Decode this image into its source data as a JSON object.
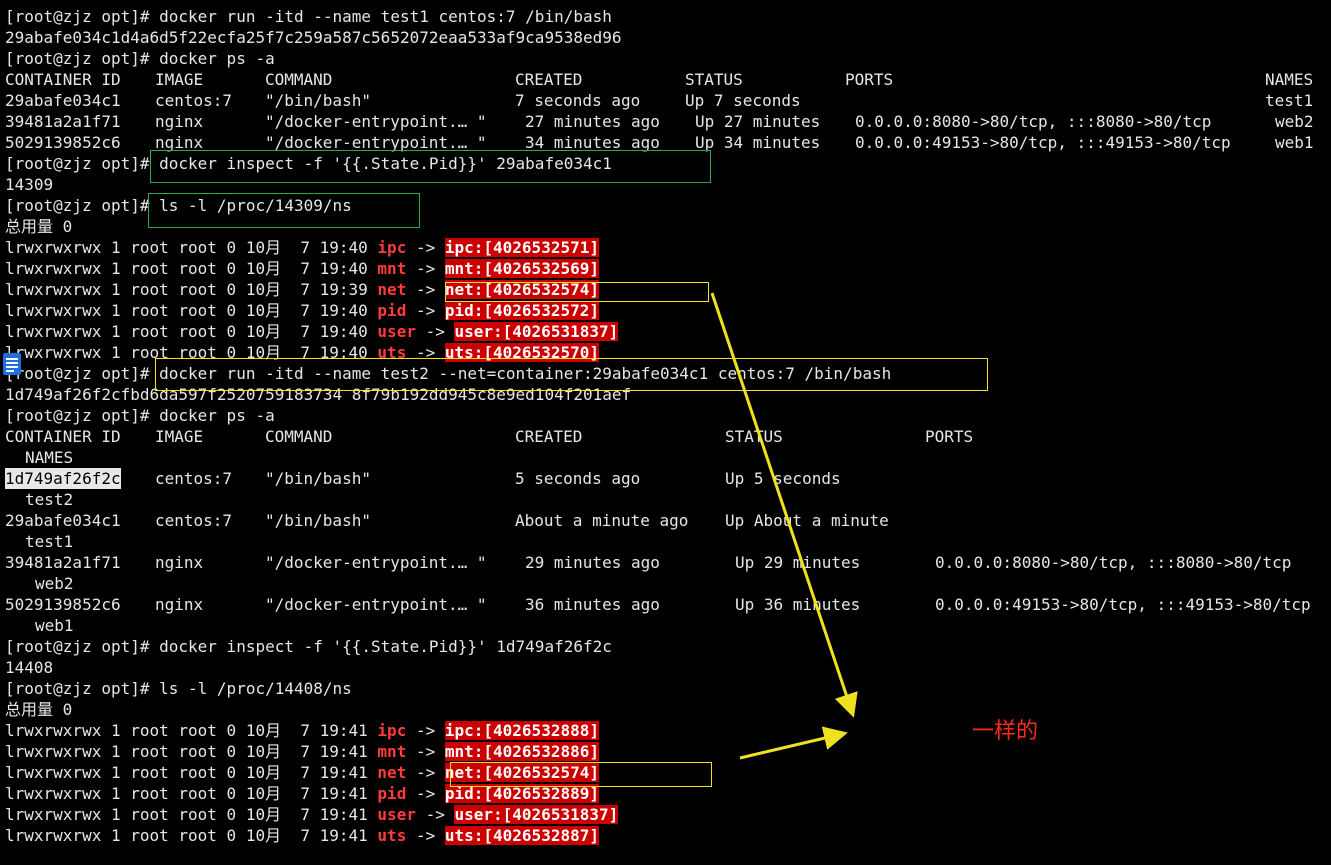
{
  "theme": {
    "background": "#000000",
    "foreground": "#e6e6e6",
    "ns_name": "#ff3b3b",
    "ns_target_bg": "#cc0000",
    "box_green": "#2fa84f",
    "box_yellow": "#f0e020",
    "arrow": "#f0e020",
    "note": "#ff2a1a"
  },
  "prompt": "[root@zjz opt]# ",
  "commands": {
    "run1": "docker run -itd --name test1 centos:7 /bin/bash",
    "ps1": "docker ps -a",
    "inspect1": "docker inspect -f '{{.State.Pid}}' 29abafe034c1",
    "ls1": "ls -l /proc/14309/ns",
    "run2": "docker run -itd --name test2 --net=container:29abafe034c1 centos:7 /bin/bash",
    "ps2": "docker ps -a",
    "inspect2": "docker inspect -f '{{.State.Pid}}' 1d749af26f2c",
    "ls2": "ls -l /proc/14408/ns"
  },
  "outputs": {
    "id1": "29abafe034c1d4a6d5f22ecfa25f7c259a587c5652072eaa533af9ca9538ed96",
    "pid1": "14309",
    "total1": "总用量 0",
    "id2": "1d749af26f2cfbd6da597f2520759183734 8f79b192dd945c8e9ed104f201aef",
    "pid2": "14408",
    "total2": "总用量 0"
  },
  "ps1": {
    "headers": [
      "CONTAINER ID",
      "IMAGE",
      "COMMAND",
      "CREATED",
      "STATUS",
      "PORTS",
      "NAMES"
    ],
    "rows": [
      {
        "id": "29abafe034c1",
        "image": "centos:7",
        "command": "\"/bin/bash\"",
        "created": "7 seconds ago",
        "status": "Up 7 seconds",
        "ports": "",
        "name": "test1"
      },
      {
        "id": "39481a2a1f71",
        "image": "nginx",
        "command": "\"/docker-entrypoint.… \"",
        "created": "27 minutes ago",
        "status": "Up 27 minutes",
        "ports": "0.0.0.0:8080->80/tcp, :::8080->80/tcp",
        "name": "web2"
      },
      {
        "id": "5029139852c6",
        "image": "nginx",
        "command": "\"/docker-entrypoint.… \"",
        "created": "34 minutes ago",
        "status": "Up 34 minutes",
        "ports": "0.0.0.0:49153->80/tcp, :::49153->80/tcp",
        "name": "web1"
      }
    ]
  },
  "ps2": {
    "headers": [
      "CONTAINER ID",
      "IMAGE",
      "COMMAND",
      "CREATED",
      "STATUS",
      "PORTS",
      "NAMES"
    ],
    "rows": [
      {
        "id": "1d749af26f2c",
        "image": "centos:7",
        "command": "\"/bin/bash\"",
        "created": "5 seconds ago",
        "status": "Up 5 seconds",
        "ports": "",
        "name": "test2"
      },
      {
        "id": "29abafe034c1",
        "image": "centos:7",
        "command": "\"/bin/bash\"",
        "created": "About a minute ago",
        "status": "Up About a minute",
        "ports": "",
        "name": "test1"
      },
      {
        "id": "39481a2a1f71",
        "image": "nginx",
        "command": "\"/docker-entrypoint.… \"",
        "created": "29 minutes ago",
        "status": "Up 29 minutes",
        "ports": "0.0.0.0:8080->80/tcp, :::8080->80/tcp",
        "name": "web2"
      },
      {
        "id": "5029139852c6",
        "image": "nginx",
        "command": "\"/docker-entrypoint.… \"",
        "created": "36 minutes ago",
        "status": "Up 36 minutes",
        "ports": "0.0.0.0:49153->80/tcp, :::49153->80/tcp",
        "name": "web1"
      }
    ]
  },
  "ns_listing_1": [
    {
      "perm": "lrwxrwxrwx 1 root root 0 10月  7 19:40 ",
      "name": "ipc",
      "arrow": " -> ",
      "target": "ipc:[4026532571]"
    },
    {
      "perm": "lrwxrwxrwx 1 root root 0 10月  7 19:40 ",
      "name": "mnt",
      "arrow": " -> ",
      "target": "mnt:[4026532569]"
    },
    {
      "perm": "lrwxrwxrwx 1 root root 0 10月  7 19:39 ",
      "name": "net",
      "arrow": " -> ",
      "target": "net:[4026532574]"
    },
    {
      "perm": "lrwxrwxrwx 1 root root 0 10月  7 19:40 ",
      "name": "pid",
      "arrow": " -> ",
      "target": "pid:[4026532572]"
    },
    {
      "perm": "lrwxrwxrwx 1 root root 0 10月  7 19:40 ",
      "name": "user",
      "arrow": " -> ",
      "target": "user:[4026531837]"
    },
    {
      "perm": "lrwxrwxrwx 1 root root 0 10月  7 19:40 ",
      "name": "uts",
      "arrow": " -> ",
      "target": "uts:[4026532570]"
    }
  ],
  "ns_listing_2": [
    {
      "perm": "lrwxrwxrwx 1 root root 0 10月  7 19:41 ",
      "name": "ipc",
      "arrow": " -> ",
      "target": "ipc:[4026532888]"
    },
    {
      "perm": "lrwxrwxrwx 1 root root 0 10月  7 19:41 ",
      "name": "mnt",
      "arrow": " -> ",
      "target": "mnt:[4026532886]"
    },
    {
      "perm": "lrwxrwxrwx 1 root root 0 10月  7 19:41 ",
      "name": "net",
      "arrow": " -> ",
      "target": "net:[4026532574]"
    },
    {
      "perm": "lrwxrwxrwx 1 root root 0 10月  7 19:41 ",
      "name": "pid",
      "arrow": " -> ",
      "target": "pid:[4026532889]"
    },
    {
      "perm": "lrwxrwxrwx 1 root root 0 10月  7 19:41 ",
      "name": "user",
      "arrow": " -> ",
      "target": "user:[4026531837]"
    },
    {
      "perm": "lrwxrwxrwx 1 root root 0 10月  7 19:41 ",
      "name": "uts",
      "arrow": " -> ",
      "target": "uts:[4026532887]"
    }
  ],
  "annotation": {
    "note": "一样的"
  },
  "icons": {
    "side_doc": "document-icon"
  }
}
